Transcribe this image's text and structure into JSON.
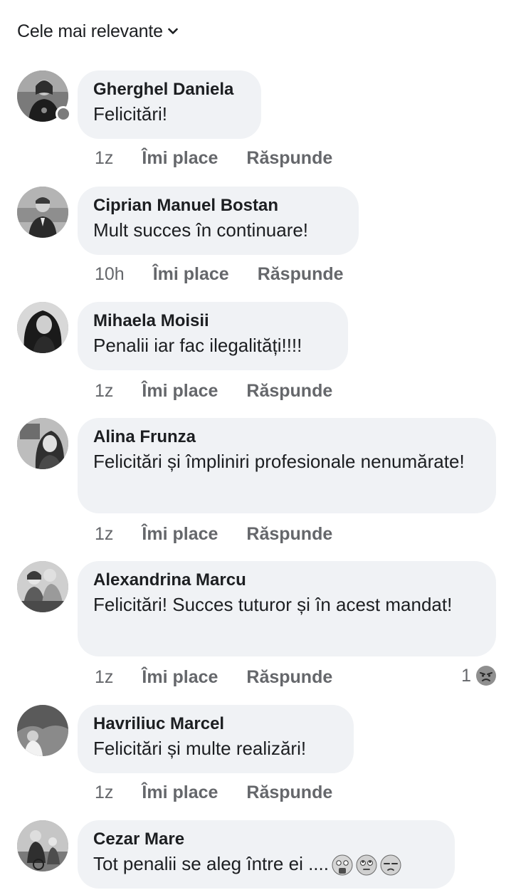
{
  "sort": {
    "label": "Cele mai relevante",
    "icon": "chevron-down-icon"
  },
  "comments": [
    {
      "author": "Gherghel Daniela",
      "text": "Felicitări!",
      "time": "1z",
      "like_label": "Îmi place",
      "reply_label": "Răspunde",
      "online": true
    },
    {
      "author": "Ciprian Manuel Bostan",
      "text": "Mult succes în continuare!",
      "time": "10h",
      "like_label": "Îmi place",
      "reply_label": "Răspunde"
    },
    {
      "author": "Mihaela Moisii",
      "text": "Penalii iar fac ilegalități!!!!",
      "time": "1z",
      "like_label": "Îmi place",
      "reply_label": "Răspunde"
    },
    {
      "author": "Alina Frunza",
      "text": "Felicitări și împliniri profesionale nenumărate!",
      "time": "1z",
      "like_label": "Îmi place",
      "reply_label": "Răspunde"
    },
    {
      "author": "Alexandrina Marcu",
      "text": "Felicitări! Succes tuturor și în acest mandat!",
      "time": "1z",
      "like_label": "Îmi place",
      "reply_label": "Răspunde",
      "reaction_count": "1",
      "reaction_icon": "angry-face-icon"
    },
    {
      "author": "Havriliuc Marcel",
      "text": "Felicitări și multe realizări!",
      "time": "1z",
      "like_label": "Îmi place",
      "reply_label": "Răspunde"
    },
    {
      "author": "Cezar Mare",
      "text": "Tot penalii se aleg între ei ....",
      "emojis": [
        "money-mouth-face-icon",
        "rolling-eyes-face-icon",
        "unamused-face-icon"
      ]
    }
  ]
}
